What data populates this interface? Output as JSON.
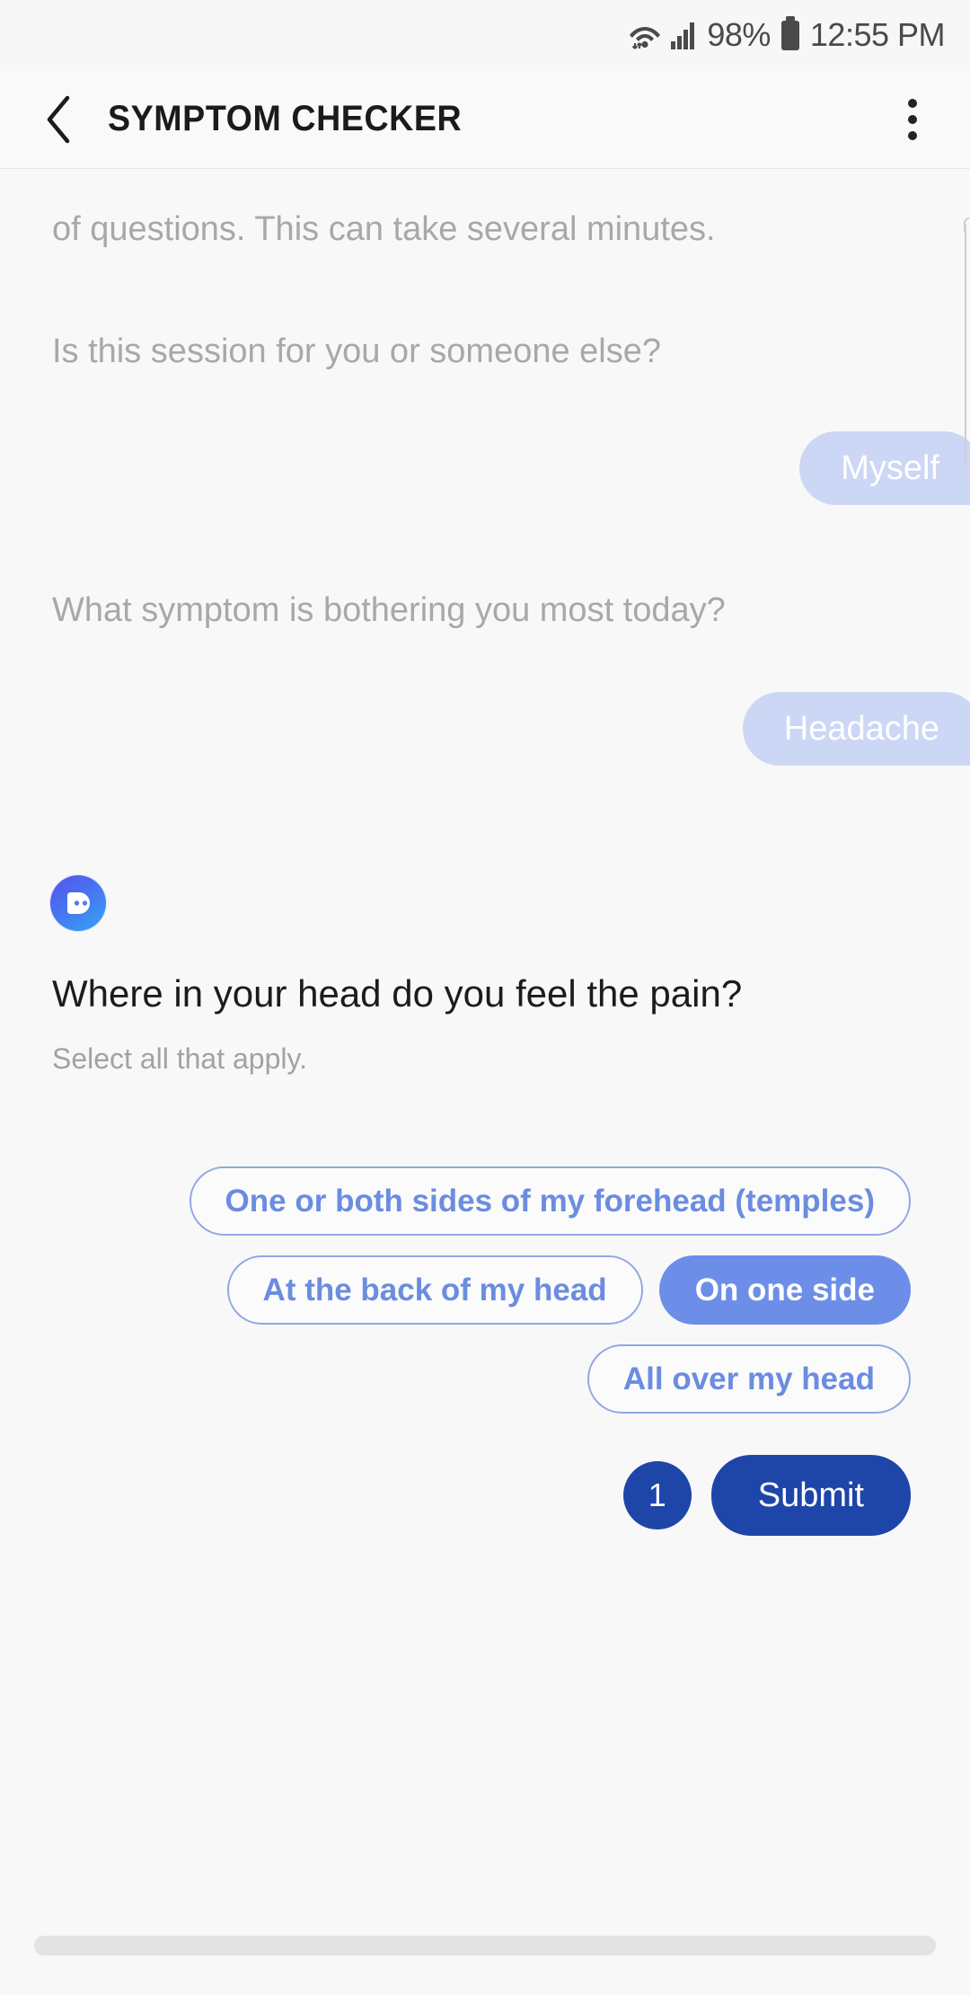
{
  "statusbar": {
    "wifi_icon": "wifi-icon",
    "signal_icon": "cellular-signal-icon",
    "battery_percent": "98%",
    "battery_icon": "battery-icon",
    "time": "12:55 PM"
  },
  "header": {
    "back_icon": "back-chevron-icon",
    "title": "SYMPTOM CHECKER",
    "menu_icon": "overflow-menu-icon"
  },
  "chat": {
    "messages": [
      {
        "role": "bot",
        "text": "of questions. This can take several minutes."
      },
      {
        "role": "bot",
        "text": "Is this session for you or someone else?"
      },
      {
        "role": "user",
        "text": "Myself"
      },
      {
        "role": "bot",
        "text": "What symptom is bothering you most today?"
      },
      {
        "role": "user",
        "text": "Headache"
      }
    ]
  },
  "question": {
    "avatar_icon": "bot-avatar-icon",
    "title": "Where in your head do you feel the pain?",
    "subtitle": "Select all that apply.",
    "options": [
      {
        "label": "One or both sides of my forehead (temples)",
        "selected": false
      },
      {
        "label": "At the back of my head",
        "selected": false
      },
      {
        "label": "On one side",
        "selected": true
      },
      {
        "label": "All over my head",
        "selected": false
      }
    ],
    "selected_count": "1",
    "submit_label": "Submit"
  },
  "colors": {
    "page_background": "#f7f7f7",
    "user_bubble": "#ccd7f5",
    "chip_border": "#91a8e0",
    "chip_text": "#6b8ce0",
    "chip_selected_bg": "#6d8ee8",
    "submit_bg": "#1e45a8",
    "bot_text_faded": "#a8a8a8",
    "title_text": "#1c1c1c"
  }
}
